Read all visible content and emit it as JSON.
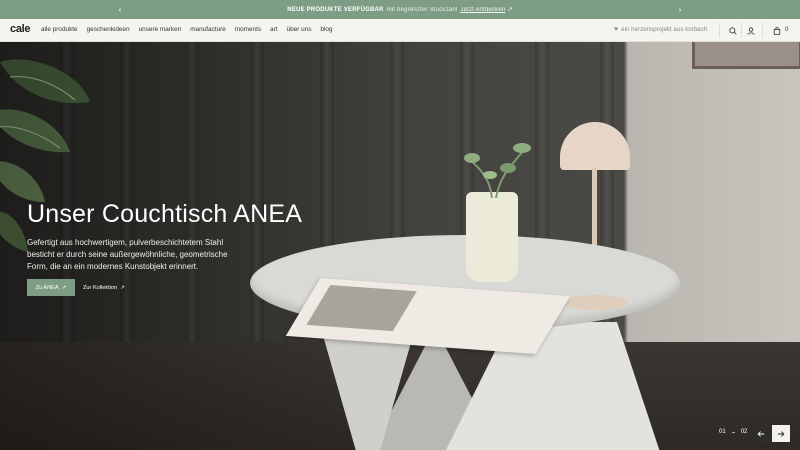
{
  "announcement": {
    "bold": "NEUE PRODUKTE VERFÜGBAR",
    "text": "mit begrenzter Stückzahl",
    "link": "Jetzt entdecken"
  },
  "header": {
    "logo": "cale",
    "nav": [
      "alle produkte",
      "geschenkideen",
      "unsere marken",
      "manufacture",
      "moments",
      "art",
      "über uns",
      "blog"
    ],
    "heart_text": "ein herzensprojekt aus korbach",
    "cart_count": "0"
  },
  "hero": {
    "title": "Unser Couchtisch ANEA",
    "text_lines": [
      "Gefertigt aus hochwertigem, pulverbeschichtetem Stahl",
      "besticht er durch seine außergewöhnliche, geometrische",
      "Form, die an ein modernes Kunstobjekt erinnert."
    ],
    "primary_button": "Zu ANEA",
    "secondary_button": "Zur Kollektion",
    "slide_current": "01",
    "slide_total": "02"
  },
  "colors": {
    "accent": "#7d9e85",
    "header_bg": "#f6f4ee"
  },
  "icons": [
    "chevron-left-icon",
    "chevron-right-icon",
    "heart-icon",
    "search-icon",
    "user-icon",
    "bag-icon",
    "arrow-up-right-icon",
    "arrow-left-icon",
    "arrow-right-icon"
  ]
}
